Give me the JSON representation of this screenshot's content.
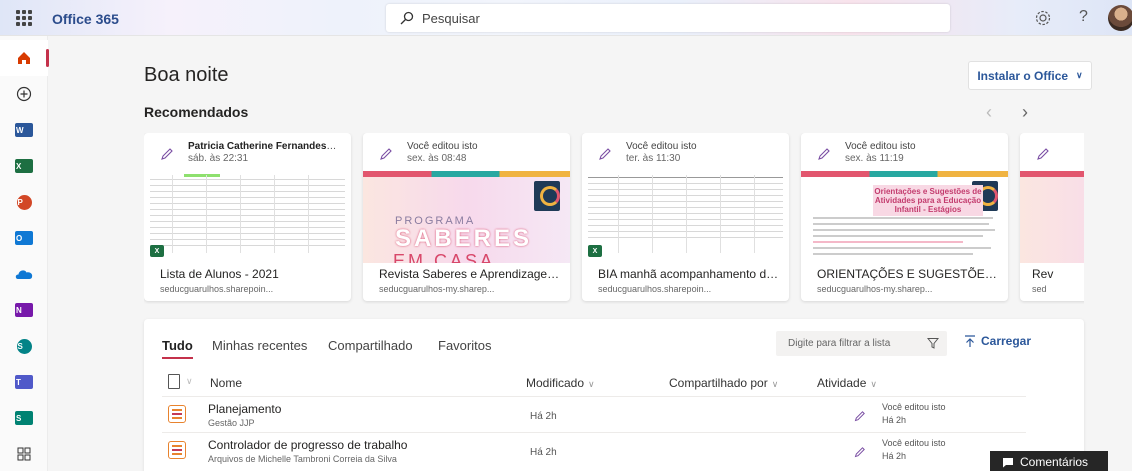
{
  "header": {
    "app_name": "Office 365",
    "search_placeholder": "Pesquisar",
    "help_label": "?"
  },
  "rail": {
    "items": [
      "home",
      "create",
      "word",
      "excel",
      "powerpoint",
      "outlook",
      "onedrive",
      "onenote",
      "sharepoint",
      "teams",
      "sway",
      "all-apps"
    ]
  },
  "main": {
    "greeting": "Boa noite",
    "install_label": "Instalar o Office",
    "recommended_title": "Recomendados",
    "cards": [
      {
        "who": "Patricia Catherine Fernandes",
        "who_suffix": " e...",
        "when": "sáb. às 22:31",
        "title": "Lista de Alunos - 2021",
        "site": "seducguarulhos.sharepoin...",
        "thumb": "sheet"
      },
      {
        "who": "Você editou isto",
        "who_suffix": "",
        "when": "sex. às 08:48",
        "title": "Revista Saberes e Aprendizagem - ...",
        "site": "seducguarulhos-my.sharep...",
        "thumb": "promo"
      },
      {
        "who": "Você editou isto",
        "who_suffix": "",
        "when": "ter. às 11:30",
        "title": "BIA manhã acompanhamento de at...",
        "site": "seducguarulhos.sharepoin...",
        "thumb": "sheet2"
      },
      {
        "who": "Você editou isto",
        "who_suffix": "",
        "when": "sex. às 11:19",
        "title": "ORIENTAÇÕES E SUGESTÕES DE AT...",
        "site": "seducguarulhos-my.sharep...",
        "thumb": "doc"
      },
      {
        "who": "",
        "who_suffix": "",
        "when": "",
        "title": "Rev",
        "site": "sed",
        "thumb": "promo"
      }
    ],
    "promo_text": {
      "program": "PROGRAMA",
      "big": "SABERES",
      "sub": "EM CASA"
    },
    "doc_heading": "Orientações e Sugestões de Atividades para a Educação Infantil - Estágios"
  },
  "files": {
    "tabs": [
      "Tudo",
      "Minhas recentes",
      "Compartilhado",
      "Favoritos"
    ],
    "filter_placeholder": "Digite para filtrar a lista",
    "upload_label": "Carregar",
    "columns": {
      "name": "Nome",
      "modified": "Modificado",
      "shared_by": "Compartilhado por",
      "activity": "Atividade"
    },
    "rows": [
      {
        "name": "Planejamento",
        "location": "Gestão JJP",
        "modified": "Há 2h",
        "activity_line1": "Você editou isto",
        "activity_line2": "Há 2h"
      },
      {
        "name": "Controlador de progresso de trabalho",
        "location": "Arquivos de Michelle Tambroni Correia da Silva",
        "modified": "Há 2h",
        "activity_line1": "Você editou isto",
        "activity_line2": "Há 2h"
      }
    ]
  },
  "feedback_label": "Comentários",
  "colors": {
    "accent": "#c4314b",
    "link": "#2b579a",
    "excel": "#1d6f42"
  }
}
